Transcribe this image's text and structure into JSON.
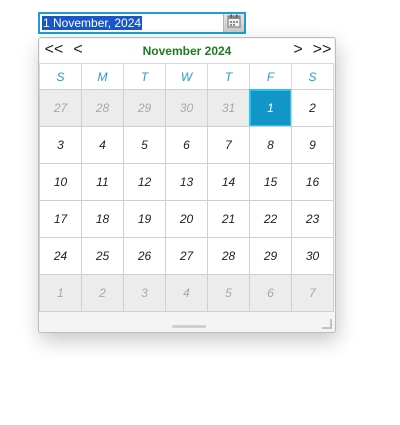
{
  "date_input": {
    "value": "1 November, 2024"
  },
  "calendar_button": {
    "icon": "calendar-icon"
  },
  "calendar": {
    "month_title": "November 2024",
    "nav": {
      "prev_year": "<<",
      "prev_month": "<",
      "next_month": ">",
      "next_year": ">>"
    },
    "weekdays": [
      "S",
      "M",
      "T",
      "W",
      "T",
      "F",
      "S"
    ],
    "weeks": [
      [
        {
          "d": "27",
          "o": true
        },
        {
          "d": "28",
          "o": true
        },
        {
          "d": "29",
          "o": true
        },
        {
          "d": "30",
          "o": true
        },
        {
          "d": "31",
          "o": true
        },
        {
          "d": "1",
          "sel": true
        },
        {
          "d": "2"
        }
      ],
      [
        {
          "d": "3"
        },
        {
          "d": "4"
        },
        {
          "d": "5"
        },
        {
          "d": "6"
        },
        {
          "d": "7"
        },
        {
          "d": "8"
        },
        {
          "d": "9"
        }
      ],
      [
        {
          "d": "10"
        },
        {
          "d": "11"
        },
        {
          "d": "12"
        },
        {
          "d": "13"
        },
        {
          "d": "14"
        },
        {
          "d": "15"
        },
        {
          "d": "16"
        }
      ],
      [
        {
          "d": "17"
        },
        {
          "d": "18"
        },
        {
          "d": "19"
        },
        {
          "d": "20"
        },
        {
          "d": "21"
        },
        {
          "d": "22"
        },
        {
          "d": "23"
        }
      ],
      [
        {
          "d": "24"
        },
        {
          "d": "25"
        },
        {
          "d": "26"
        },
        {
          "d": "27"
        },
        {
          "d": "28"
        },
        {
          "d": "29"
        },
        {
          "d": "30"
        }
      ],
      [
        {
          "d": "1",
          "o": true
        },
        {
          "d": "2",
          "o": true
        },
        {
          "d": "3",
          "o": true
        },
        {
          "d": "4",
          "o": true
        },
        {
          "d": "5",
          "o": true
        },
        {
          "d": "6",
          "o": true
        },
        {
          "d": "7",
          "o": true
        }
      ]
    ]
  },
  "colors": {
    "month_title": "#1f7a1f",
    "weekday": "#2a9bc0",
    "selected_day_bg": "#1296c7",
    "input_border": "#1a9fd6"
  }
}
